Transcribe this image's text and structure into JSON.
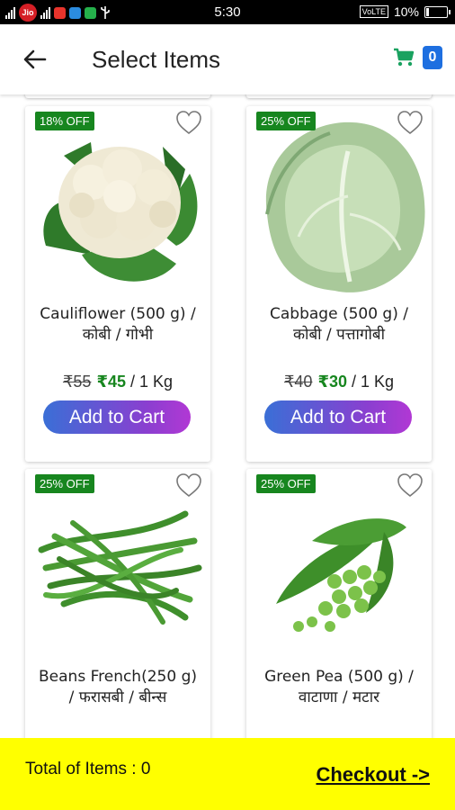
{
  "status_bar": {
    "carrier": "Jio",
    "time": "5:30",
    "network_badge": "VoLTE",
    "battery": "10%"
  },
  "app_bar": {
    "title": "Select Items",
    "cart_count": "0",
    "icons": {
      "back": "arrow-left-icon",
      "cart": "cart-icon"
    },
    "cart_color": "#1aa260"
  },
  "products": [
    {
      "discount": "18% OFF",
      "name_line1": "Cauliflower (500 g) /",
      "name_line2": "कोबी / गोभी",
      "old_price": "₹55",
      "new_price": "₹45",
      "unit": " / 1 Kg",
      "button": "Add to Cart"
    },
    {
      "discount": "25% OFF",
      "name_line1": "Cabbage (500 g) /",
      "name_line2": "कोबी / पत्तागोबी",
      "old_price": "₹40",
      "new_price": "₹30",
      "unit": " / 1 Kg",
      "button": "Add to Cart"
    },
    {
      "discount": "25% OFF",
      "name_line1": "Beans French(250 g)",
      "name_line2": "/ फरासबी / बीन्स"
    },
    {
      "discount": "25% OFF",
      "name_line1": "Green Pea (500 g) /",
      "name_line2": "वाटाणा / मटार"
    }
  ],
  "footer": {
    "total_label": "Total of Items : 0",
    "checkout_label": "Checkout ->"
  },
  "colors": {
    "discount_badge": "#17861f",
    "new_price": "#17861f",
    "footer_bg": "#ffff00",
    "button_gradient": [
      "#3a6fd6",
      "#b138d4"
    ]
  }
}
